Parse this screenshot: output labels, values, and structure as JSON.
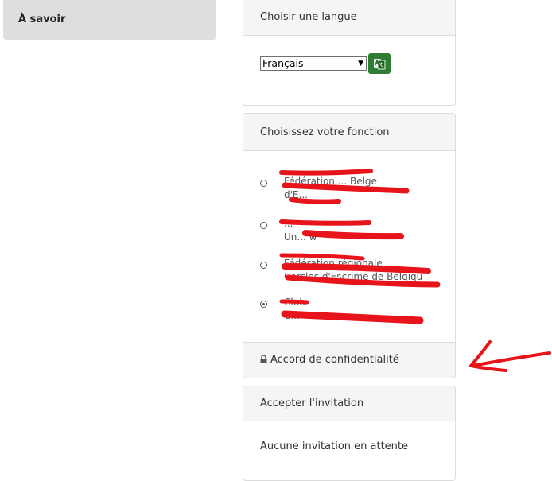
{
  "sidebar": {
    "active_label": "À savoir"
  },
  "language_panel": {
    "title": "Choisir une langue",
    "selected_language": "Français",
    "translate_icon": "translate-icon"
  },
  "function_panel": {
    "title": "Choisissez votre fonction",
    "options": [
      {
        "label_line1": "Fédération ... Belge",
        "label_line2": "d'E...",
        "checked": false
      },
      {
        "label_line1": "...",
        "label_line2": "Un... w",
        "checked": false
      },
      {
        "label_line1": "Fédération régionale",
        "label_line2": "Cercles d'Escrime de Belgique",
        "checked": false
      },
      {
        "label_line1": "Club",
        "label_line2": "C...",
        "checked": true
      }
    ],
    "privacy_link": "Accord de confidentialité",
    "privacy_icon": "lock-icon"
  },
  "invitation_panel": {
    "title": "Accepter l'invitation",
    "empty_text": "Aucune invitation en attente"
  },
  "annotation": {
    "arrow_color": "#e8141b",
    "redaction_color": "#e8141b"
  }
}
